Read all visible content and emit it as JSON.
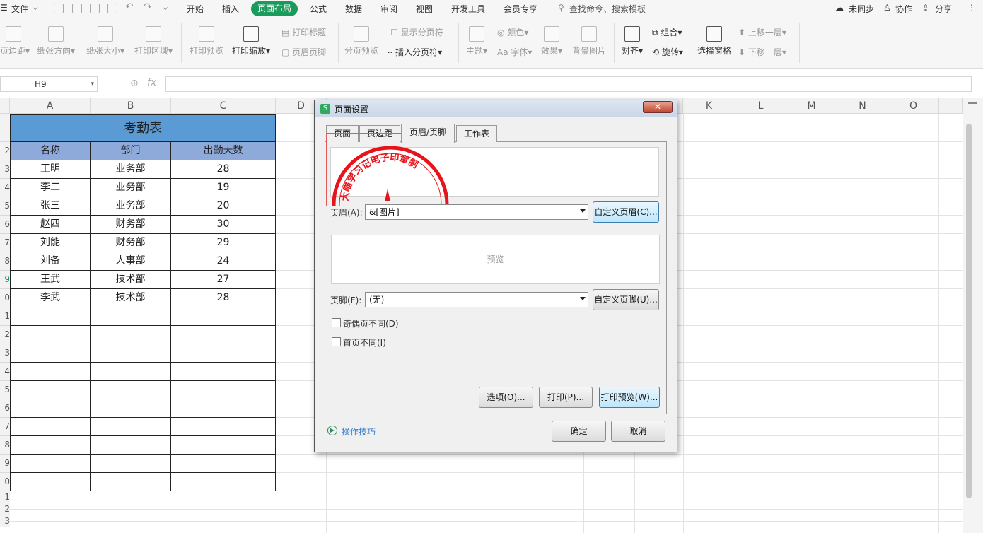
{
  "menubar": {
    "file": "文件",
    "tabs": [
      "开始",
      "插入",
      "页面布局",
      "公式",
      "数据",
      "审阅",
      "视图",
      "开发工具",
      "会员专享"
    ],
    "search": "查找命令、搜索模板",
    "sync": "未同步",
    "collab": "协作",
    "share": "分享"
  },
  "ribbon": {
    "margins": "页边距",
    "orientation": "纸张方向",
    "size": "纸张大小",
    "print_area": "打印区域",
    "print_preview": "打印预览",
    "print_scale": "打印缩放",
    "print_titles": "打印标题",
    "header_footer": "页眉页脚",
    "page_break_preview": "分页预览",
    "show_page_break": "显示分页符",
    "insert_page_break": "插入分页符",
    "theme": "主题",
    "colors": "颜色",
    "fonts": "字体",
    "effects": "效果",
    "background": "背景图片",
    "align": "对齐",
    "group": "组合",
    "rotate": "旋转",
    "selection_pane": "选择窗格",
    "bring_forward": "上移一层",
    "send_backward": "下移一层"
  },
  "formula_bar": {
    "name_box": "H9",
    "fx": "fx"
  },
  "sheet": {
    "columns": [
      "A",
      "B",
      "C",
      "D",
      "K",
      "L",
      "M",
      "N",
      "O"
    ],
    "row_numbers": [
      "",
      "2",
      "3",
      "4",
      "5",
      "6",
      "7",
      "8",
      "9",
      "0",
      "1",
      "2",
      "3",
      "4",
      "5",
      "6",
      "7",
      "8",
      "9",
      "0",
      "1",
      "2",
      "3"
    ],
    "title": "考勤表",
    "headers": [
      "名称",
      "部门",
      "出勤天数"
    ],
    "rows": [
      [
        "王明",
        "业务部",
        "28"
      ],
      [
        "李二",
        "业务部",
        "19"
      ],
      [
        "张三",
        "业务部",
        "20"
      ],
      [
        "赵四",
        "财务部",
        "30"
      ],
      [
        "刘能",
        "财务部",
        "29"
      ],
      [
        "刘备",
        "人事部",
        "24"
      ],
      [
        "王武",
        "技术部",
        "27"
      ],
      [
        "李武",
        "技术部",
        "28"
      ]
    ]
  },
  "dialog": {
    "title": "页面设置",
    "tabs": [
      "页面",
      "页边距",
      "页眉/页脚",
      "工作表"
    ],
    "stamp_text": "大喵学习记电子印章制",
    "header_label": "页眉(A):",
    "header_value": "&[图片]",
    "custom_header": "自定义页眉(C)...",
    "preview": "预览",
    "footer_label": "页脚(F):",
    "footer_value": "(无)",
    "custom_footer": "自定义页脚(U)...",
    "odd_even": "奇偶页不同(D)",
    "first_page": "首页不同(I)",
    "options": "选项(O)...",
    "print": "打印(P)...",
    "print_preview": "打印预览(W)...",
    "tips": "操作技巧",
    "ok": "确定",
    "cancel": "取消"
  },
  "colors": {
    "accent": "#1a9b5c",
    "title_fill": "#5b9bd5",
    "header_fill": "#8eaadb",
    "stamp_red": "#e8141b"
  }
}
